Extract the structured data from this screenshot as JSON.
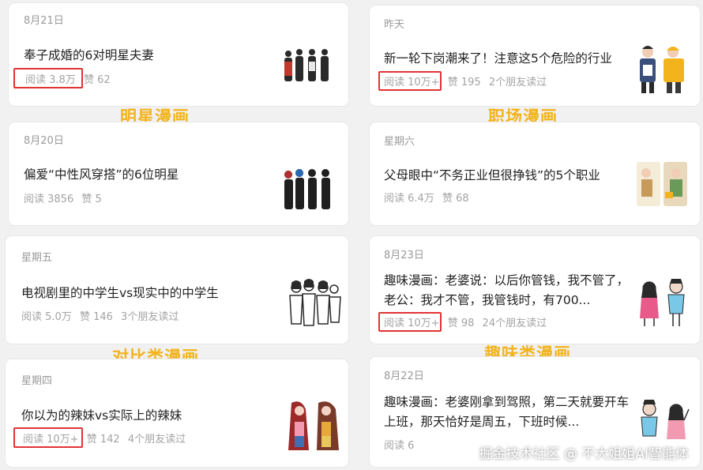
{
  "left_column": [
    {
      "date": "8月21日",
      "title": "奉子成婚的6对明星夫妻",
      "read": "阅读 3.8万",
      "likes": "赞 62",
      "friends": ""
    },
    {
      "date": "8月20日",
      "title": "偏爱“中性风穿搭”的6位明星",
      "read": "阅读 3856",
      "likes": "赞 5",
      "friends": ""
    },
    {
      "date": "星期五",
      "title": "电视剧里的中学生vs现实中的中学生",
      "read": "阅读 5.0万",
      "likes": "赞 146",
      "friends": "3个朋友读过"
    },
    {
      "date": "星期四",
      "title": "你以为的辣妹vs实际上的辣妹",
      "read": "阅读 10万+",
      "likes": "赞 142",
      "friends": "4个朋友读过"
    }
  ],
  "right_column": [
    {
      "date": "昨天",
      "title": "新一轮下岗潮来了！注意这5个危险的行业",
      "read": "阅读 10万+",
      "likes": "赞 195",
      "friends": "2个朋友读过"
    },
    {
      "date": "星期六",
      "title": "父母眼中“不务正业但很挣钱”的5个职业",
      "read": "阅读 6.4万",
      "likes": "赞 68",
      "friends": ""
    },
    {
      "date": "8月23日",
      "title": "趣味漫画：老婆说：以后你管钱，我不管了，老公：我才不管，我管钱时，有700...",
      "read": "阅读 10万+",
      "likes": "赞 98",
      "friends": "24个朋友读过"
    },
    {
      "date": "8月22日",
      "title": "趣味漫画：老婆刚拿到驾照，第二天就要开车上班，那天恰好是周五，下班时候...",
      "read": "阅读 6",
      "likes": "",
      "friends": ""
    }
  ],
  "section_labels": {
    "celebrity": "明星漫画",
    "workplace": "职场漫画",
    "comparison": "对比类漫画",
    "fun": "趣味类漫画"
  },
  "watermark": "掘金技术社区 @ 不大姐姐AI智能体",
  "colors": {
    "highlight": "#e13333",
    "label": "#f3b31c"
  }
}
